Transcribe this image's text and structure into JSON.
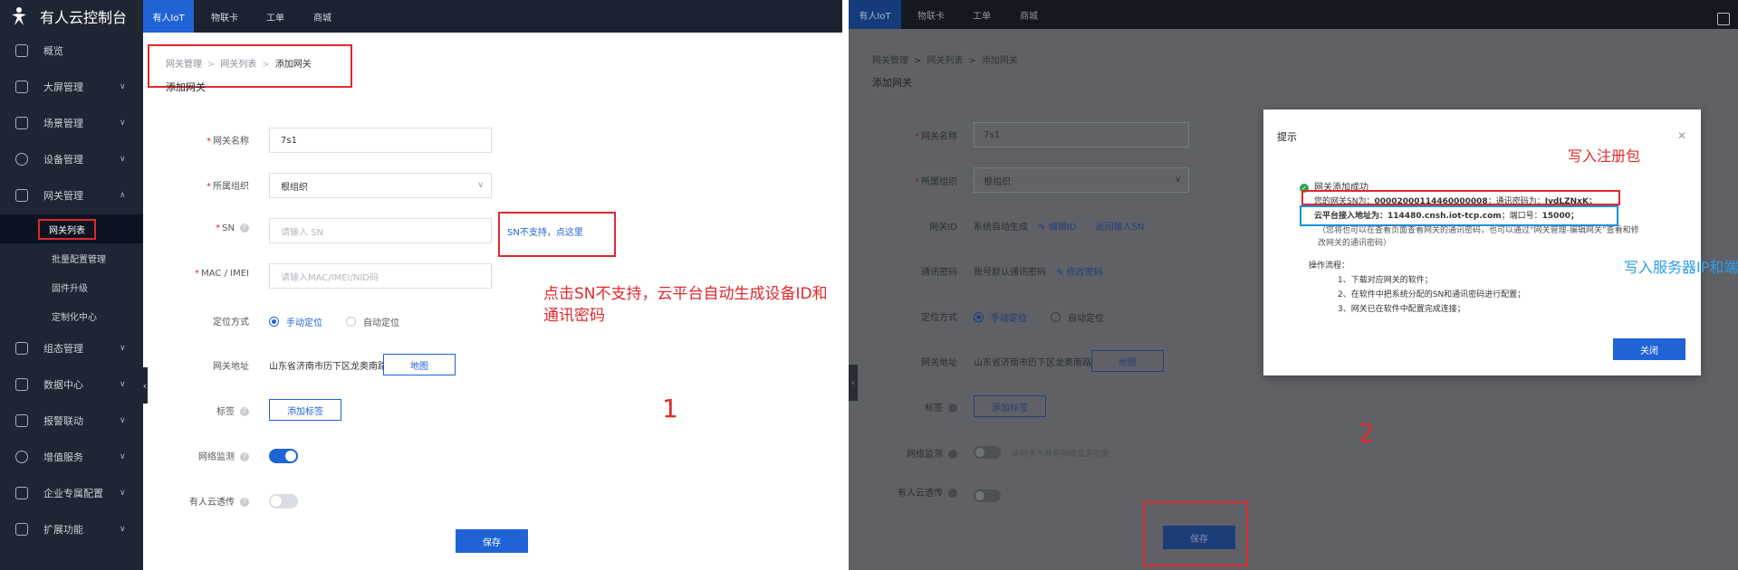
{
  "left": {
    "logo_text": "有人云控制台",
    "topnav": [
      "有人IoT",
      "物联卡",
      "工单",
      "商城"
    ],
    "sidebar": {
      "items": [
        {
          "label": "概览"
        },
        {
          "label": "大屏管理"
        },
        {
          "label": "场景管理"
        },
        {
          "label": "设备管理"
        },
        {
          "label": "网关管理"
        },
        {
          "label": "组态管理"
        },
        {
          "label": "数据中心"
        },
        {
          "label": "报警联动"
        },
        {
          "label": "增值服务"
        },
        {
          "label": "企业专属配置"
        },
        {
          "label": "扩展功能"
        }
      ],
      "sub_items": [
        "网关列表",
        "批量配置管理",
        "固件升级",
        "定制化中心"
      ]
    },
    "breadcrumb": [
      "网关管理",
      "网关列表",
      "添加网关"
    ],
    "page_title": "添加网关",
    "form": {
      "name_label": "网关名称",
      "name_value": "7s1",
      "org_label": "所属组织",
      "org_value": "根组织",
      "sn_label": "SN",
      "sn_placeholder": "请输入 SN",
      "sn_link": "SN不支持，点这里",
      "mac_label": "MAC / IMEI",
      "mac_placeholder": "请输入MAC/IMEI/NID码",
      "locate_label": "定位方式",
      "locate_manual": "手动定位",
      "locate_auto": "自动定位",
      "addr_label": "网关地址",
      "addr_value": "山东省济南市历下区龙奥南路",
      "map_btn": "地图",
      "tag_label": "标签",
      "tag_btn": "添加标签",
      "monitor_label": "网络监测",
      "monitor_on": true,
      "passthrough_label": "有人云透传",
      "passthrough_on": false,
      "save_btn": "保存"
    },
    "annotation": {
      "text": "点击SN不支持，云平台自动生成设备ID和通讯密码",
      "number": "1"
    }
  },
  "right": {
    "topnav": [
      "有人IoT",
      "物联卡",
      "工单",
      "商城"
    ],
    "breadcrumb": [
      "网关管理",
      "网关列表",
      "添加网关"
    ],
    "page_title": "添加网关",
    "form": {
      "name_label": "网关名称",
      "name_value": "7s1",
      "org_label": "所属组织",
      "org_value": "根组织",
      "id_label": "网关ID",
      "id_value": "系统自动生成",
      "id_edit": "编辑ID",
      "id_back": "返回输入SN",
      "pwd_label": "通讯密码",
      "pwd_value": "账号默认通讯密码",
      "pwd_edit": "修改密码",
      "locate_label": "定位方式",
      "locate_manual": "手动定位",
      "locate_auto": "自动定位",
      "addr_label": "网关地址",
      "addr_value": "山东省济南市历下区龙奥南路",
      "map_btn": "地图",
      "tag_label": "标签",
      "tag_btn": "添加标签",
      "monitor_label": "网络监测",
      "monitor_hint": "该网关不具有网络监测功能",
      "passthrough_label": "有人云透传",
      "save_btn": "保存"
    },
    "dialog": {
      "title": "提示",
      "success": "网关添加成功",
      "sn_prefix": "您的网关SN为：",
      "sn_value": "00002000114460000008",
      "pwd_prefix": "；通讯密码为：",
      "pwd_value": "JvdLZNxK",
      "server_prefix": "云平台接入地址为：",
      "server_value": "114480.cnsh.iot-tcp.com",
      "port_prefix": "；端口号：",
      "port_value": "15000",
      "note1": "（您将也可以在查看页面查看网关的通讯密码，也可以通过“网关管理-编辑网关”查看和修",
      "note2": "改网关的通讯密码）",
      "steps_title": "操作流程：",
      "steps": [
        "1、下载对应网关的软件；",
        "2、在软件中把系统分配的SN和通讯密码进行配置；",
        "3、网关已在软件中配置完成连接；"
      ],
      "close_btn": "关闭"
    },
    "annotation": {
      "register": "写入注册包",
      "server": "写入服务器IP和端口",
      "number": "2"
    }
  },
  "colors": {
    "accent": "#1f63d6",
    "annotation_red": "#e0282c",
    "annotation_blue": "#1a8fe0",
    "sidebar_bg": "#1f2633"
  }
}
